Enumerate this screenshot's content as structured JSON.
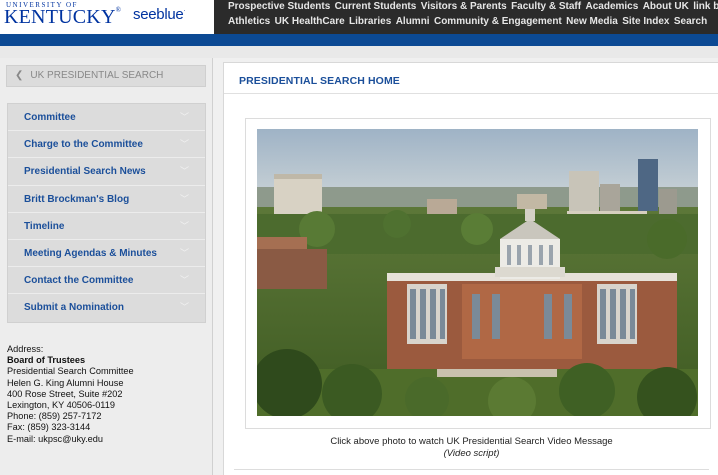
{
  "header": {
    "logo_university": "UNIVERSITY OF",
    "logo_kentucky": "KENTUCKY",
    "logo_reg": "®",
    "logo_seeblue": "seeblue",
    "logo_dot": ".",
    "topnav_row1": [
      "Prospective Students",
      "Current Students",
      "Visitors & Parents",
      "Faculty & Staff",
      "Academics",
      "About UK",
      "link blue"
    ],
    "topnav_row2": [
      "Athletics",
      "UK HealthCare",
      "Libraries",
      "Alumni",
      "Community & Engagement",
      "New Media",
      "Site Index",
      "Search"
    ]
  },
  "sidebar": {
    "back_label": "UK PRESIDENTIAL SEARCH",
    "items": [
      {
        "label": "Committee"
      },
      {
        "label": "Charge to the Committee"
      },
      {
        "label": "Presidential Search News"
      },
      {
        "label": "Britt Brockman's Blog"
      },
      {
        "label": "Timeline"
      },
      {
        "label": "Meeting Agendas & Minutes"
      },
      {
        "label": "Contact the Committee"
      },
      {
        "label": "Submit a Nomination"
      }
    ],
    "address": {
      "heading": "Address:",
      "org": "Board of Trustees",
      "line1": "Presidential Search Committee",
      "line2": "Helen G. King Alumni House",
      "line3": "400 Rose Street, Suite #202",
      "line4": "Lexington, KY 40506-0119",
      "phone": "Phone: (859) 257-7172",
      "fax": "Fax: (859) 323-3144",
      "email": "E-mail: ukpsc@uky.edu"
    }
  },
  "main": {
    "title": "PRESIDENTIAL SEARCH HOME",
    "caption": "Click above photo to watch UK Presidential Search Video Message",
    "caption_link": "(Video script)"
  },
  "colors": {
    "brand_blue": "#0033a0",
    "nav_bar": "#2b2b2b",
    "blue_bar": "#0c4a94",
    "link_blue": "#1b4f9a"
  }
}
